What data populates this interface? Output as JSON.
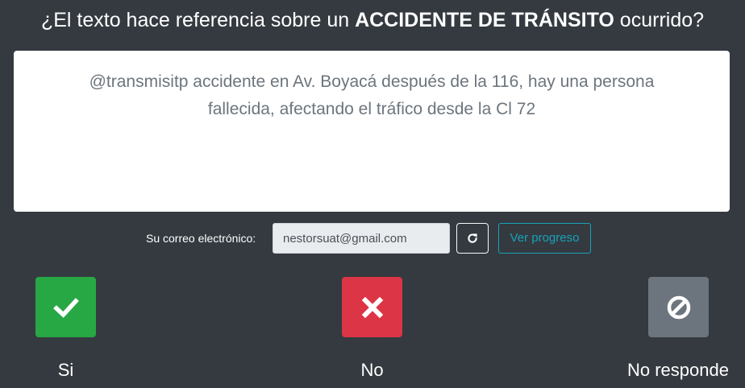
{
  "question": {
    "prefix": "¿El texto hace referencia sobre un ",
    "highlight": "ACCIDENTE DE TRÁNSITO",
    "suffix": " ocurrido?"
  },
  "tweet_text": "@transmisitp accidente en Av. Boyacá después de la 116, hay una persona fallecida, afectando el tráfico desde la Cl 72",
  "email": {
    "label": "Su correo electrónico:",
    "value": "nestorsuat@gmail.com",
    "refresh_icon": "refresh-icon",
    "progress_label": "Ver progreso"
  },
  "answers": [
    {
      "label": "Si",
      "icon": "check-icon",
      "color": "#28a745"
    },
    {
      "label": "No",
      "icon": "close-icon",
      "color": "#dc3545"
    },
    {
      "label": "No responde",
      "icon": "ban-icon",
      "color": "#6c757d"
    }
  ],
  "colors": {
    "background": "#343a40",
    "accent_info": "#17a2b8"
  }
}
